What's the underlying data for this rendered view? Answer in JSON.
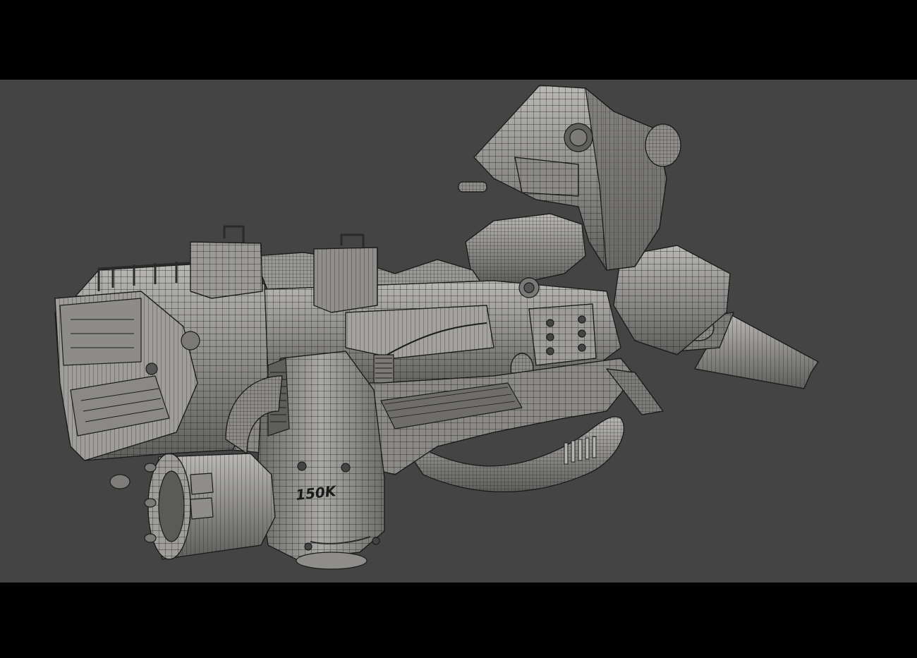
{
  "viewport": {
    "background_color": "#444444",
    "letterbox_color": "#000000",
    "mesh_fill_color": "#8f8f8d",
    "mesh_highlight_color": "#c4c3bf",
    "mesh_shadow_color": "#5a5a58",
    "wire_color": "#1c1c1c"
  },
  "model": {
    "label_text": "150K"
  }
}
